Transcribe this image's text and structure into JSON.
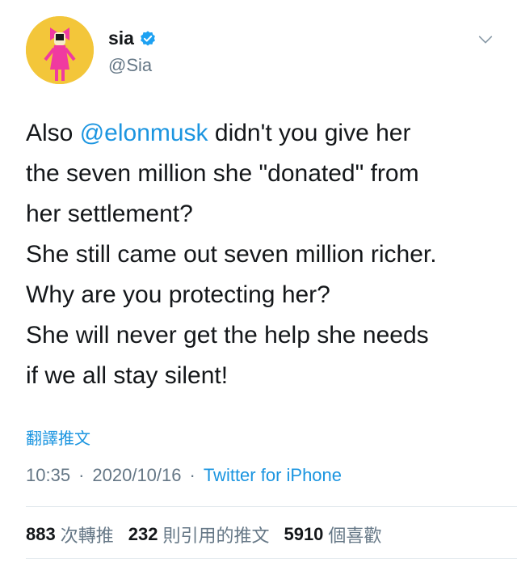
{
  "tweet": {
    "display_name": "sia",
    "handle": "@Sia",
    "body": {
      "l1_pre": "Also ",
      "mention": "@elonmusk",
      "l1_post": " didn't you give her",
      "l2": "the seven million she \"donated\" from",
      "l3": "her settlement?",
      "l4": "She still came out seven million richer.",
      "l5": "Why are you protecting her?",
      "l6": "She will never get the help she needs",
      "l7": "if we all stay silent!"
    },
    "translate_label": "翻譯推文",
    "time": "10:35",
    "date": "2020/10/16",
    "source": "Twitter for iPhone",
    "stats": {
      "retweets_count": "883",
      "retweets_label": "次轉推",
      "quotes_count": "232",
      "quotes_label": "則引用的推文",
      "likes_count": "5910",
      "likes_label": "個喜歡"
    }
  },
  "colors": {
    "link": "#1b95e0",
    "muted": "#657786",
    "text": "#14171a",
    "avatar_bg": "#f3c63a"
  },
  "icons": {
    "verified": "verified-badge-icon",
    "menu": "chevron-down-icon"
  }
}
